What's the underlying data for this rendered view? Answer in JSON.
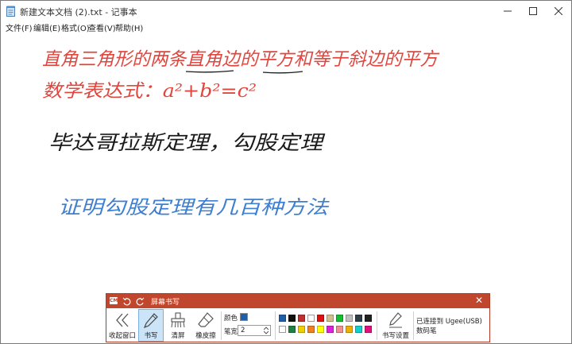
{
  "window": {
    "title": "新建文本文档 (2).txt - 记事本",
    "minimize_glyph": "—",
    "maximize_glyph": "☐",
    "close_glyph": "✕"
  },
  "menu": [
    {
      "label": "文件(F)"
    },
    {
      "label": "编辑(E)"
    },
    {
      "label": "格式(O)"
    },
    {
      "label": "查看(V)"
    },
    {
      "label": "帮助(H)"
    }
  ],
  "handwriting": {
    "line1": "直角三角形的两条直角边的平方和等于斜边的平方",
    "line2": "数学表达式：a²+b²=c²",
    "line3": "毕达哥拉斯定理，勾股定理",
    "line4": "证明勾股定理有几百种方法"
  },
  "colors": {
    "red_ink": "#e0463e",
    "black_ink": "#1a1a1a",
    "blue_ink": "#3f7fcf",
    "panel_accent": "#c0462d"
  },
  "toolbar": {
    "logo": "CM",
    "title": "屏幕书写",
    "close_glyph": "✕",
    "collapse_label": "收起窗口",
    "write_label": "书写",
    "clear_label": "清屏",
    "eraser_label": "橡皮擦",
    "color_label": "颜色",
    "stroke_label": "笔宽",
    "stroke_value": "2",
    "settings_label": "书写设置",
    "status_text": "已连接到 Ugee(USB) 数码笔",
    "current_color": "#1f5fa8",
    "palette_row1": [
      "#1f5fa8",
      "#111111",
      "#c03030",
      "#ffffff",
      "#e01010",
      "#d0c090",
      "#10c030",
      "#c0c0c0",
      "#2e3f4a",
      "#222222"
    ],
    "palette_row2": [
      "#ffffff",
      "#208040",
      "#f0d000",
      "#f08020",
      "#ffff00",
      "#e020e0",
      "#f09090",
      "#f0b000",
      "#10d0d0",
      "#e01080"
    ]
  }
}
